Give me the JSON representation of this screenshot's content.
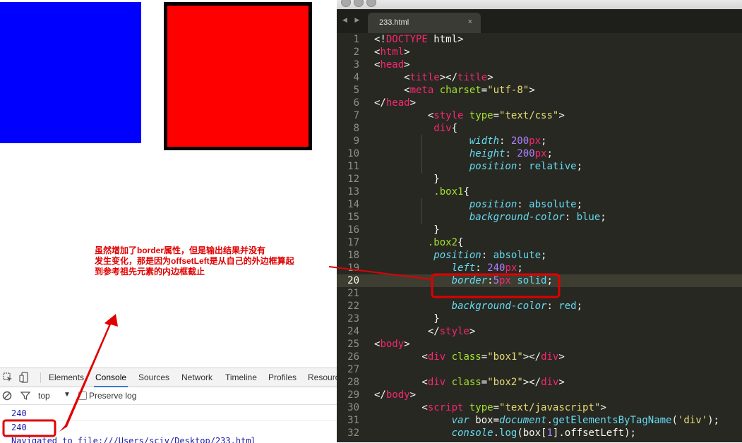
{
  "devtools": {
    "tabs": [
      "Elements",
      "Console",
      "Sources",
      "Network",
      "Timeline",
      "Profiles",
      "Resources"
    ],
    "active_tab": "Console",
    "context": "top",
    "preserve_log_label": "Preserve log",
    "console_lines": [
      "240",
      "240",
      "Navigated to file:///Users/sciv/Desktop/233.html"
    ]
  },
  "editor": {
    "tab_title": "233.html",
    "tab_close": "×",
    "nav_arrows": "◀ ▶",
    "active_line": 20
  },
  "annotation": {
    "lines": [
      "虽然增加了border属性，但是输出结果并没有",
      "发生变化，那是因为offsetLeft是从自己的外边框算起",
      "到参考祖先元素的内边框截止"
    ]
  },
  "colors": {
    "box1": "#0000ff",
    "box2": "#ff0000",
    "annotation": "#e00000",
    "editor_bg": "#272822"
  }
}
